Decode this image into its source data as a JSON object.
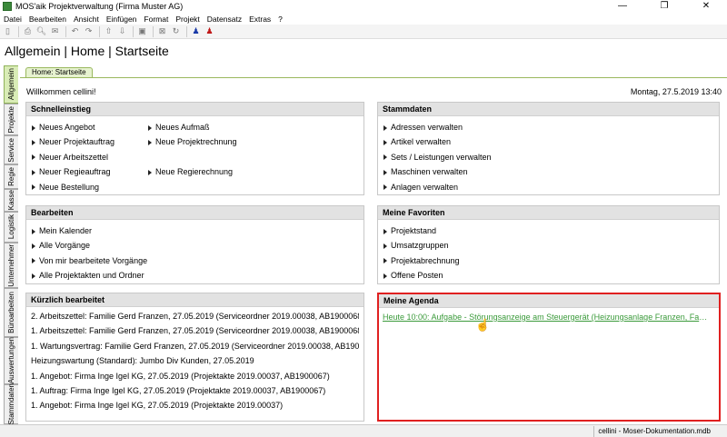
{
  "window": {
    "title": "MOS'aik Projektverwaltung (Firma Muster AG)",
    "minimize": "—",
    "restore": "❐",
    "close": "✕"
  },
  "menu": [
    "Datei",
    "Bearbeiten",
    "Ansicht",
    "Einfügen",
    "Format",
    "Projekt",
    "Datensatz",
    "Extras",
    "?"
  ],
  "header": {
    "breadcrumb": "Allgemein | Home | Startseite"
  },
  "side_tabs": [
    "Allgemein",
    "Projekte",
    "Service",
    "Regie",
    "Kasse",
    "Logistik",
    "Unternehmer",
    "Büroarbeiten",
    "Auswertungen",
    "Stammdaten"
  ],
  "home_tab": "Home: Startseite",
  "welcome": "Willkommen cellini!",
  "datetime": "Montag, 27.5.2019 13:40",
  "schnelleinstieg": {
    "title": "Schnelleinstieg",
    "col1": [
      "Neues Angebot",
      "Neuer Projektauftrag",
      "Neuer Arbeitszettel",
      "Neuer Regieauftrag",
      "Neue Bestellung"
    ],
    "col2": [
      "Neues Aufmaß",
      "Neue Projektrechnung",
      "",
      "Neue Regierechnung"
    ]
  },
  "stammdaten": {
    "title": "Stammdaten",
    "items": [
      "Adressen verwalten",
      "Artikel verwalten",
      "Sets / Leistungen verwalten",
      "Maschinen verwalten",
      "Anlagen verwalten"
    ]
  },
  "bearbeiten": {
    "title": "Bearbeiten",
    "items": [
      "Mein Kalender",
      "Alle Vorgänge",
      "Von mir bearbeitete Vorgänge",
      "Alle Projektakten und Ordner"
    ]
  },
  "favoriten": {
    "title": "Meine Favoriten",
    "items": [
      "Projektstand",
      "Umsatzgruppen",
      "Projektabrechnung",
      "Offene Posten"
    ]
  },
  "recent": {
    "title": "Kürzlich bearbeitet",
    "items": [
      "2. Arbeitszettel: Familie Gerd Franzen, 27.05.2019 (Serviceordner 2019.00038, AB1900068)",
      "1. Arbeitszettel: Familie Gerd Franzen, 27.05.2019 (Serviceordner 2019.00038, AB1900068)",
      "1. Wartungsvertrag: Familie Gerd Franzen, 27.05.2019 (Serviceordner 2019.00038, AB1900...",
      "Heizungswartung (Standard): Jumbo Div Kunden, 27.05.2019",
      "1. Angebot: Firma Inge Igel KG, 27.05.2019 (Projektakte 2019.00037, AB1900067)",
      "1. Auftrag: Firma Inge Igel KG, 27.05.2019 (Projektakte 2019.00037, AB1900067)",
      "1. Angebot: Firma Inge Igel KG, 27.05.2019 (Projektakte 2019.00037)"
    ]
  },
  "agenda": {
    "title": "Meine Agenda",
    "items": [
      "Heute 10:00: Aufgabe - Störungsanzeige am Steuergerät (Heizungsanlage Franzen, Famile Ge..."
    ]
  },
  "status": {
    "db": "cellini - Moser-Dokumentation.mdb"
  }
}
